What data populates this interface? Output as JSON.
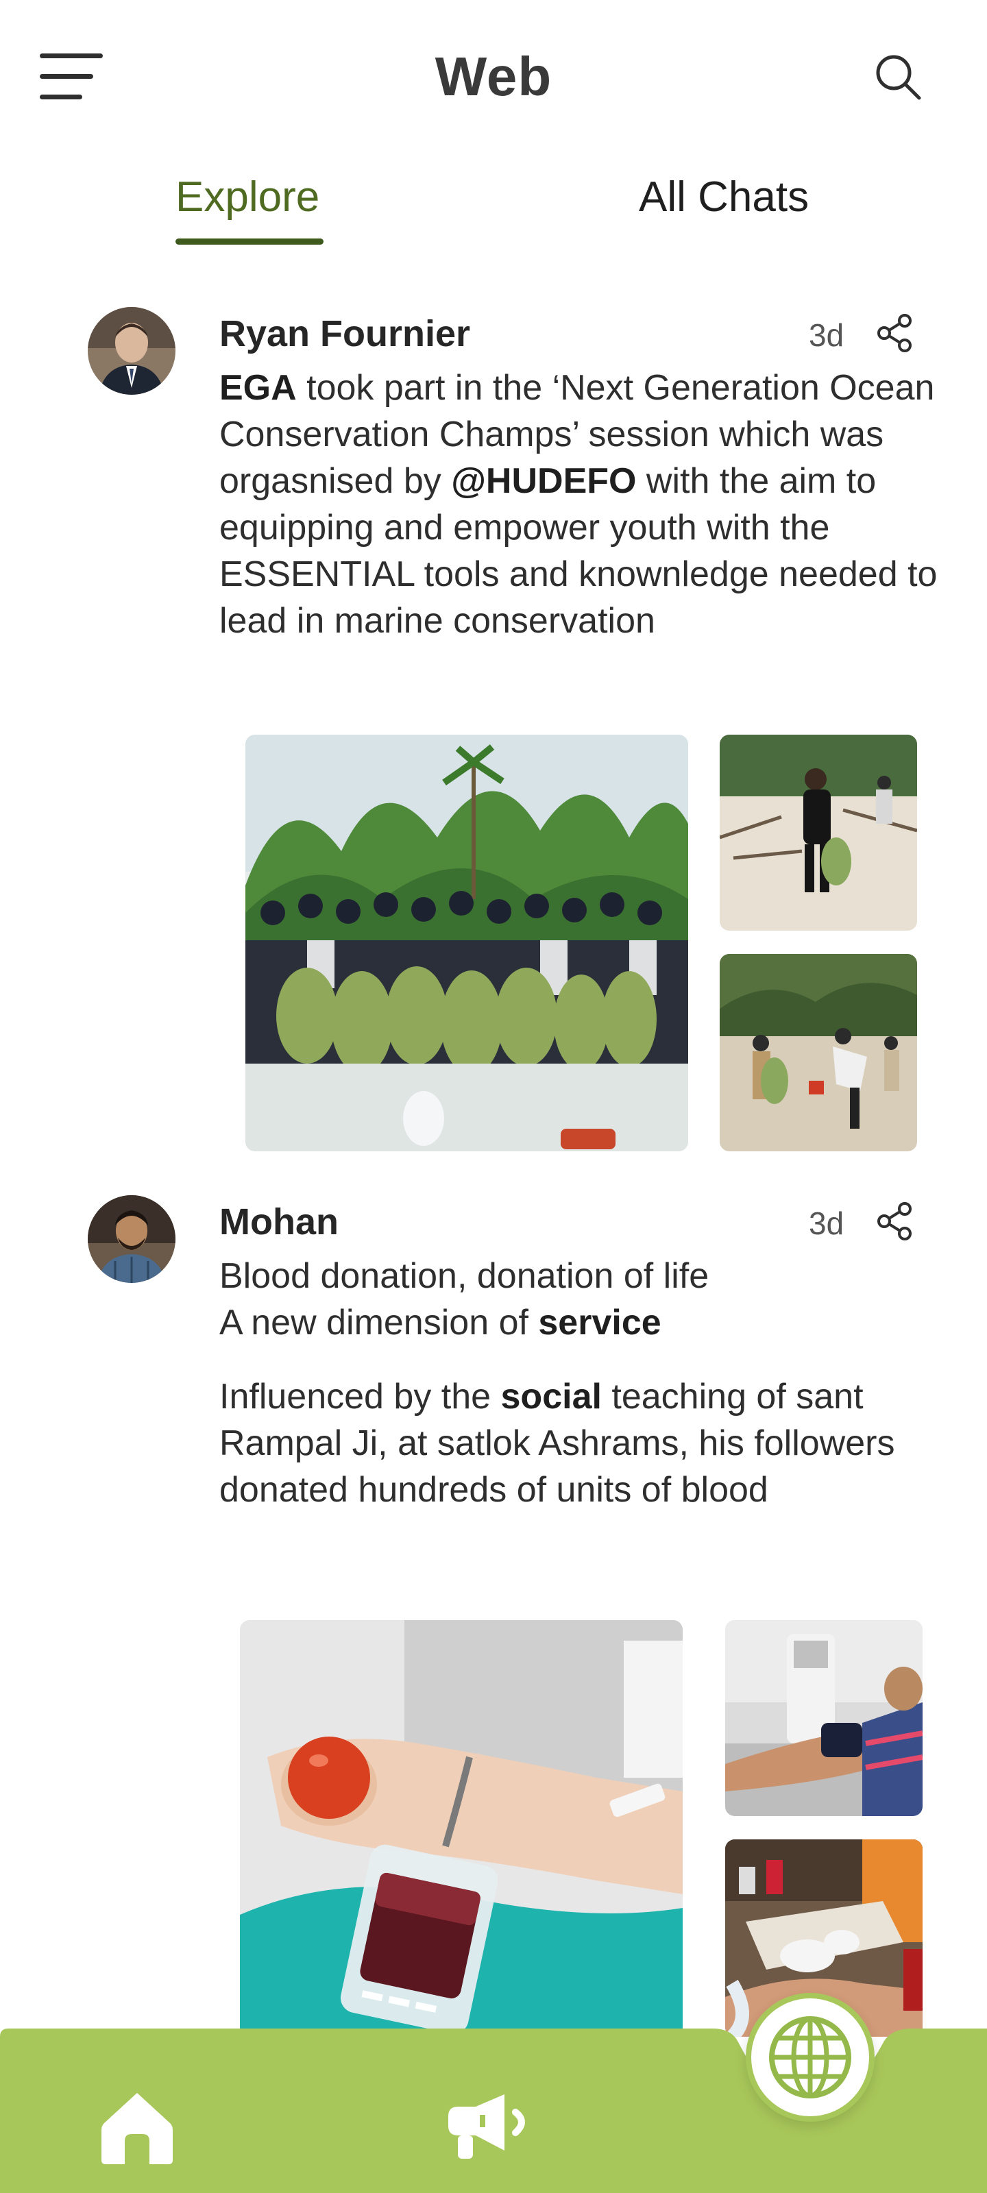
{
  "header": {
    "title": "Web",
    "menu_icon": "hamburger-menu-icon",
    "search_icon": "search-icon"
  },
  "tabs": [
    {
      "label": "Explore",
      "active": true
    },
    {
      "label": "All Chats",
      "active": false
    }
  ],
  "colors": {
    "accent": "#4f6b22",
    "nav_green": "#a8c75a",
    "underline": "#3f5a1d"
  },
  "posts": [
    {
      "author": "Ryan Fournier",
      "time": "3d",
      "share_icon": "share-icon",
      "segments": [
        {
          "text": "EGA",
          "bold": true
        },
        {
          "text": " took part in the ‘Next Generation Ocean Conservation Champs’ session which was orgasnised by ",
          "bold": false
        },
        {
          "text": "@HUDEFO",
          "bold": true
        },
        {
          "text": " with the aim to equipping and empower youth with the ESSENTIAL tools and knownledge needed to lead in marine conservation",
          "bold": false
        }
      ],
      "images": [
        "beach-cleanup-group-photo",
        "beach-cleanup-volunteer",
        "beach-cleanup-collecting-waste"
      ]
    },
    {
      "author": "Mohan",
      "time": "3d",
      "share_icon": "share-icon",
      "paragraphs": [
        [
          {
            "text": "Blood donation, donation of life",
            "bold": false,
            "break": true
          },
          {
            "text": "A new dimension of ",
            "bold": false
          },
          {
            "text": "service",
            "bold": true
          }
        ],
        [
          {
            "text": "Influenced by the ",
            "bold": false
          },
          {
            "text": "social",
            "bold": true
          },
          {
            "text": " teaching of sant Rampal Ji, at satlok Ashrams, his followers donated hundreds of units of blood",
            "bold": false
          }
        ]
      ],
      "images": [
        "blood-donation-arm-and-bag",
        "blood-donor-on-chair",
        "blood-collection-lab"
      ]
    }
  ],
  "bottom_nav": {
    "items": [
      "home-icon",
      "megaphone-icon"
    ],
    "fab_icon": "globe-icon"
  }
}
